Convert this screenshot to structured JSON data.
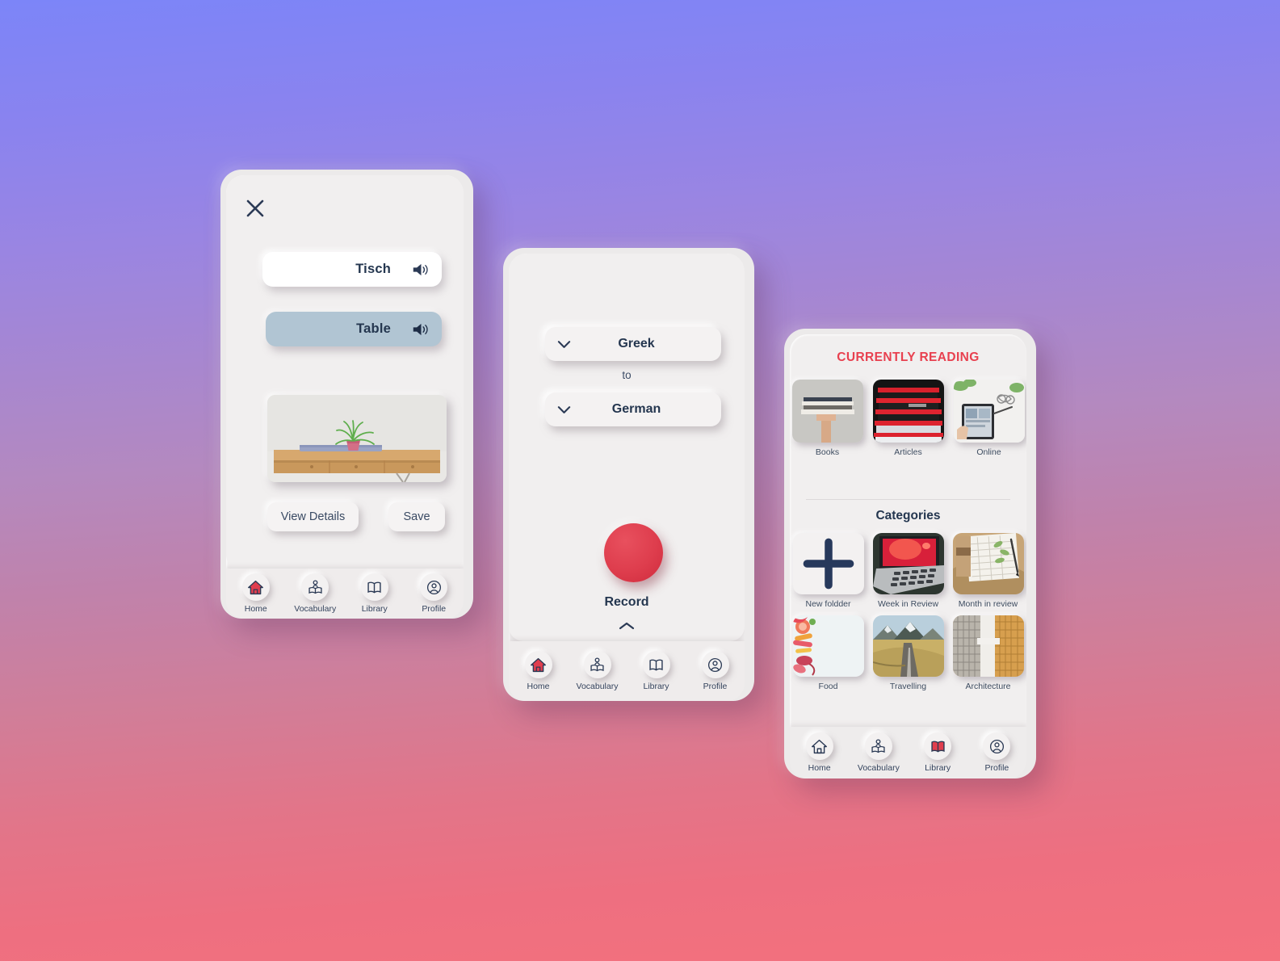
{
  "theme": {
    "bg_gradient_top": "#7c85f8",
    "bg_gradient_mid": "#b489bf",
    "bg_gradient_bottom": "#f4717d",
    "surface": "#f1efef",
    "navy": "#24364f",
    "accent_red": "#e03e4e",
    "highlight_blue_gray": "#b1c5d3"
  },
  "phone1": {
    "close_icon": "close-icon",
    "source_word": "Tisch",
    "target_word": "Table",
    "speaker_icon": "speaker-icon",
    "image_alt": "wooden-shelf-with-plant",
    "view_details_label": "View Details",
    "save_label": "Save",
    "nav": {
      "active": "Home",
      "items": [
        {
          "label": "Home",
          "icon": "home-icon",
          "active": true
        },
        {
          "label": "Vocabulary",
          "icon": "person-reading-icon",
          "active": false
        },
        {
          "label": "Library",
          "icon": "open-book-icon",
          "active": false
        },
        {
          "label": "Profile",
          "icon": "user-circle-icon",
          "active": false
        }
      ]
    }
  },
  "phone2": {
    "language_from": "Greek",
    "language_to": "German",
    "to_label": "to",
    "chevron_down_icon": "chevron-down-icon",
    "record_label": "Record",
    "record_button": "record-button",
    "expand_icon": "chevron-up-icon",
    "nav": {
      "active": "Home",
      "items": [
        {
          "label": "Home",
          "icon": "home-icon",
          "active": true
        },
        {
          "label": "Vocabulary",
          "icon": "person-reading-icon",
          "active": false
        },
        {
          "label": "Library",
          "icon": "open-book-icon",
          "active": false
        },
        {
          "label": "Profile",
          "icon": "user-circle-icon",
          "active": false
        }
      ]
    }
  },
  "phone3": {
    "currently_reading_title": "CURRENTLY READING",
    "prev_icon": "chevron-left-icon",
    "next_icon": "chevron-right-icon",
    "reading_items": [
      {
        "label": "Books",
        "image_alt": "hand-holding-stack-of-books"
      },
      {
        "label": "Articles",
        "image_alt": "red-and-black-magazines"
      },
      {
        "label": "Online",
        "image_alt": "hands-holding-tablet-on-desk"
      }
    ],
    "categories_title": "Categories",
    "categories": [
      {
        "label": "New foldder",
        "image_alt": "plus-icon",
        "is_add": true
      },
      {
        "label": "Week in Review",
        "image_alt": "laptop-with-red-screen"
      },
      {
        "label": "Month in review",
        "image_alt": "open-notebook-with-pen"
      },
      {
        "label": "Food",
        "image_alt": "colorful-food-flatlay"
      },
      {
        "label": "Travelling",
        "image_alt": "mountain-road-landscape"
      },
      {
        "label": "Architecture",
        "image_alt": "glass-building-facade"
      }
    ],
    "nav": {
      "active": "Library",
      "items": [
        {
          "label": "Home",
          "icon": "home-icon",
          "active": false
        },
        {
          "label": "Vocabulary",
          "icon": "person-reading-icon",
          "active": false
        },
        {
          "label": "Library",
          "icon": "open-book-icon",
          "active": true
        },
        {
          "label": "Profile",
          "icon": "user-circle-icon",
          "active": false
        }
      ]
    }
  }
}
